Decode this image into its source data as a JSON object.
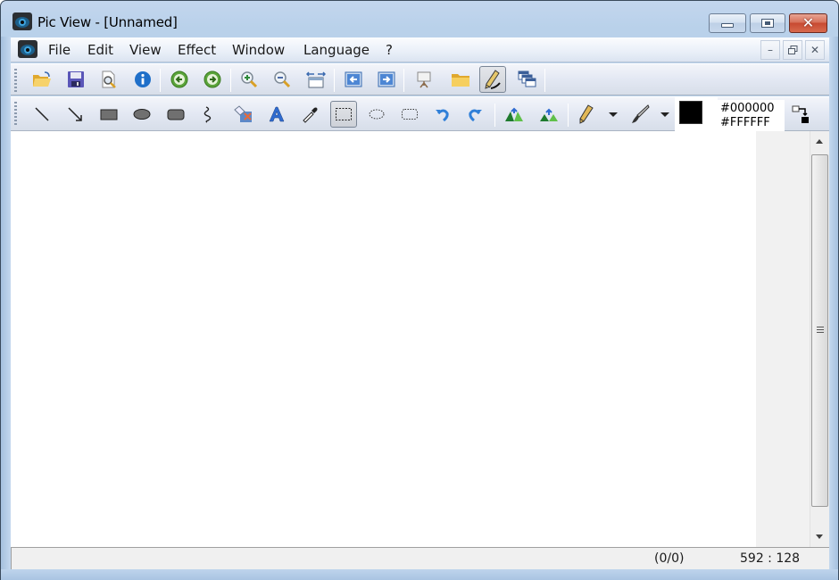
{
  "window": {
    "title": "Pic View - [Unnamed]",
    "controls": {
      "minimize": "minimize",
      "maximize": "maximize",
      "close": "✕"
    }
  },
  "menubar": {
    "items": [
      {
        "label": "File"
      },
      {
        "label": "Edit"
      },
      {
        "label": "View"
      },
      {
        "label": "Effect"
      },
      {
        "label": "Window"
      },
      {
        "label": "Language"
      },
      {
        "label": "?"
      }
    ],
    "mdi_controls": {
      "minimize": "–",
      "restore": "🗗",
      "close": "✕"
    }
  },
  "toolbar1": {
    "buttons": [
      {
        "icon": "open-folder-icon",
        "tooltip": "Open"
      },
      {
        "icon": "save-disk-icon",
        "tooltip": "Save"
      },
      {
        "icon": "print-preview-icon",
        "tooltip": "Preview"
      },
      {
        "icon": "info-icon",
        "tooltip": "Info"
      },
      {
        "icon": "previous-icon",
        "tooltip": "Previous"
      },
      {
        "icon": "next-icon",
        "tooltip": "Next"
      },
      {
        "icon": "zoom-in-icon",
        "tooltip": "Zoom In"
      },
      {
        "icon": "zoom-out-icon",
        "tooltip": "Zoom Out"
      },
      {
        "icon": "fit-width-icon",
        "tooltip": "Fit"
      },
      {
        "icon": "first-image-icon",
        "tooltip": "First"
      },
      {
        "icon": "last-image-icon",
        "tooltip": "Last"
      },
      {
        "icon": "slideshow-icon",
        "tooltip": "Slideshow"
      },
      {
        "icon": "folder-icon",
        "tooltip": "Browse"
      },
      {
        "icon": "edit-mode-icon",
        "tooltip": "Edit mode",
        "active": true
      },
      {
        "icon": "cascade-windows-icon",
        "tooltip": "Windows"
      }
    ]
  },
  "toolbar2": {
    "tools": [
      {
        "icon": "line-tool-icon"
      },
      {
        "icon": "arrow-tool-icon"
      },
      {
        "icon": "rectangle-tool-icon"
      },
      {
        "icon": "ellipse-tool-icon"
      },
      {
        "icon": "rounded-rect-tool-icon"
      },
      {
        "icon": "freehand-tool-icon"
      },
      {
        "icon": "fill-bucket-icon"
      },
      {
        "icon": "text-tool-icon"
      },
      {
        "icon": "color-picker-icon"
      },
      {
        "icon": "rect-select-icon",
        "active": true
      },
      {
        "icon": "ellipse-select-icon"
      },
      {
        "icon": "rounded-select-icon"
      },
      {
        "icon": "undo-icon"
      },
      {
        "icon": "redo-icon"
      },
      {
        "icon": "flip-horizontal-icon"
      },
      {
        "icon": "flip-vertical-icon"
      },
      {
        "icon": "pencil-icon"
      },
      {
        "icon": "brush-icon"
      }
    ],
    "colors": {
      "foreground": "#000000",
      "background": "#FFFFFF",
      "foreground_label": "#000000",
      "background_label": "#FFFFFF"
    }
  },
  "statusbar": {
    "position": "(0/0)",
    "dimensions": "592 : 128"
  }
}
